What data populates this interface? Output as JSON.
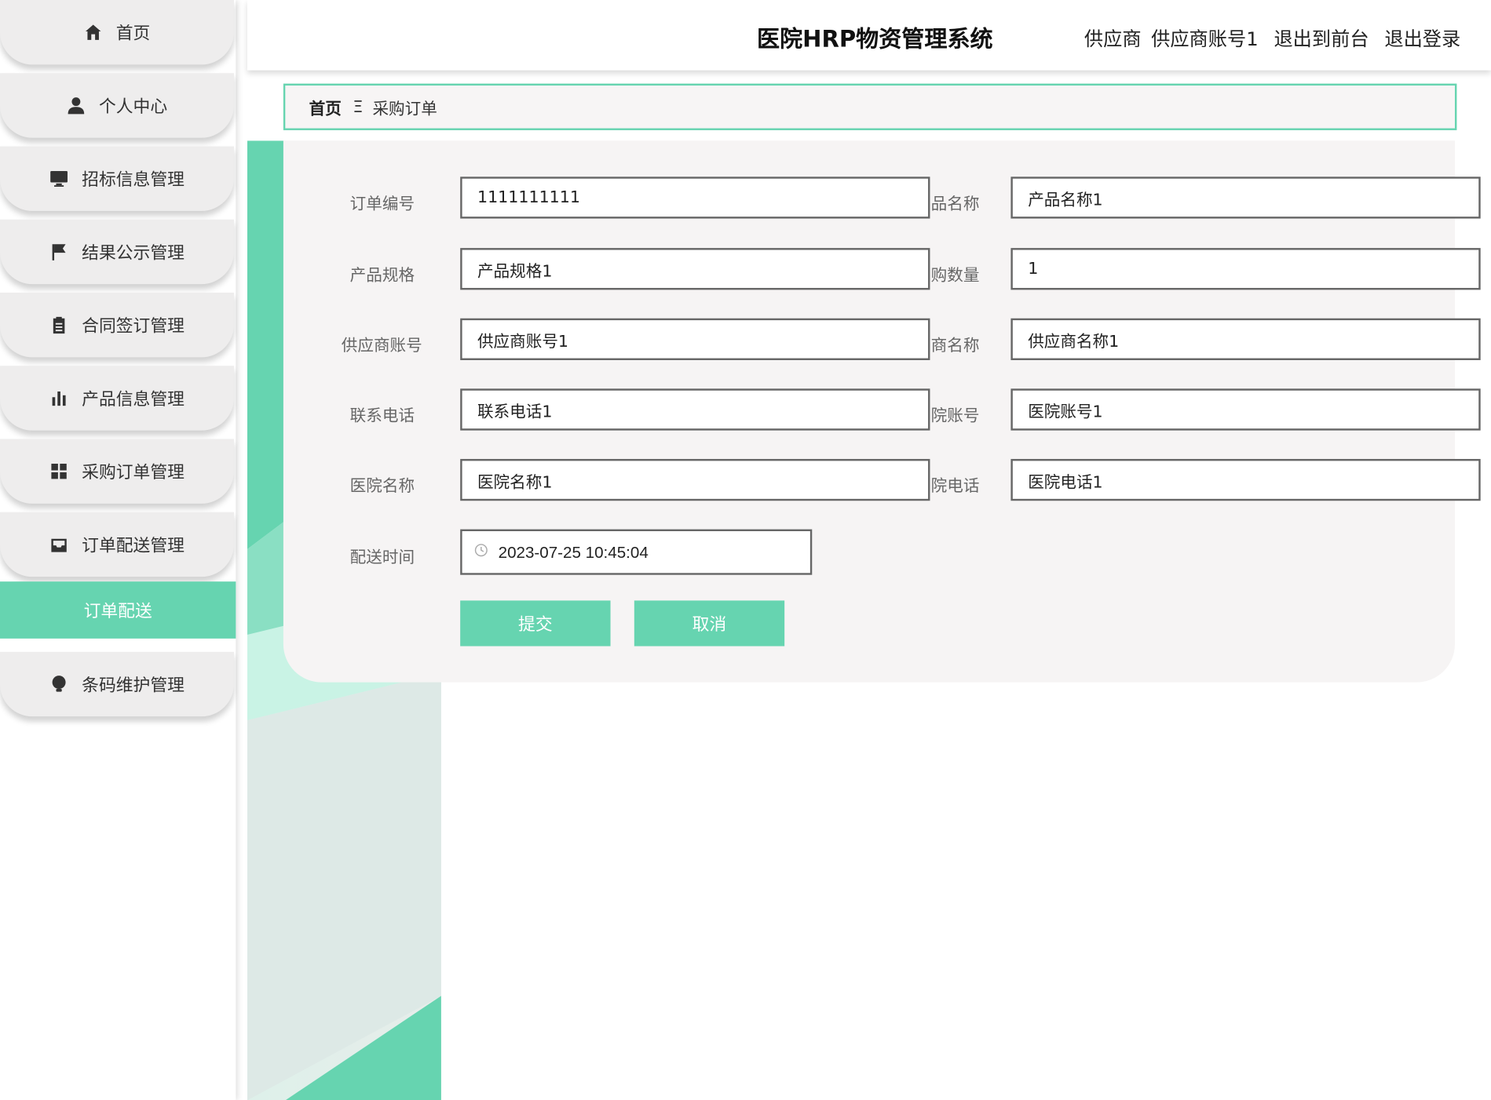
{
  "colors": {
    "accent": "#66d4b0",
    "panel": "#f6f4f4",
    "menu_bg": "#eeeded"
  },
  "header": {
    "title": "医院HRP物资管理系统",
    "role": "供应商",
    "account": "供应商账号1",
    "to_front": "退出到前台",
    "logout": "退出登录"
  },
  "sidebar": {
    "items": [
      {
        "label": "首页",
        "icon": "home-icon"
      },
      {
        "label": "个人中心",
        "icon": "person-icon"
      },
      {
        "label": "招标信息管理",
        "icon": "monitor-icon"
      },
      {
        "label": "结果公示管理",
        "icon": "flag-icon"
      },
      {
        "label": "合同签订管理",
        "icon": "clipboard-icon"
      },
      {
        "label": "产品信息管理",
        "icon": "bar-chart-icon"
      },
      {
        "label": "采购订单管理",
        "icon": "grid-icon"
      },
      {
        "label": "订单配送管理",
        "icon": "inbox-icon"
      },
      {
        "label": "条码维护管理",
        "icon": "bulb-icon"
      }
    ],
    "active_sub": "订单配送"
  },
  "breadcrumb": {
    "home": "首页",
    "separator": "Ξ",
    "current": "采购订单"
  },
  "form": {
    "left": [
      {
        "label": "订单编号",
        "value": "1111111111"
      },
      {
        "label": "产品规格",
        "value": "产品规格1"
      },
      {
        "label": "供应商账号",
        "value": "供应商账号1"
      },
      {
        "label": "联系电话",
        "value": "联系电话1"
      },
      {
        "label": "医院名称",
        "value": "医院名称1"
      }
    ],
    "right": [
      {
        "label": "品名称",
        "value": "产品名称1"
      },
      {
        "label": "购数量",
        "value": "1"
      },
      {
        "label": "商名称",
        "value": "供应商名称1"
      },
      {
        "label": "院账号",
        "value": "医院账号1"
      },
      {
        "label": "院电话",
        "value": "医院电话1"
      }
    ],
    "delivery_time": {
      "label": "配送时间",
      "value": "2023-07-25 10:45:04"
    },
    "submit": "提交",
    "cancel": "取消"
  }
}
